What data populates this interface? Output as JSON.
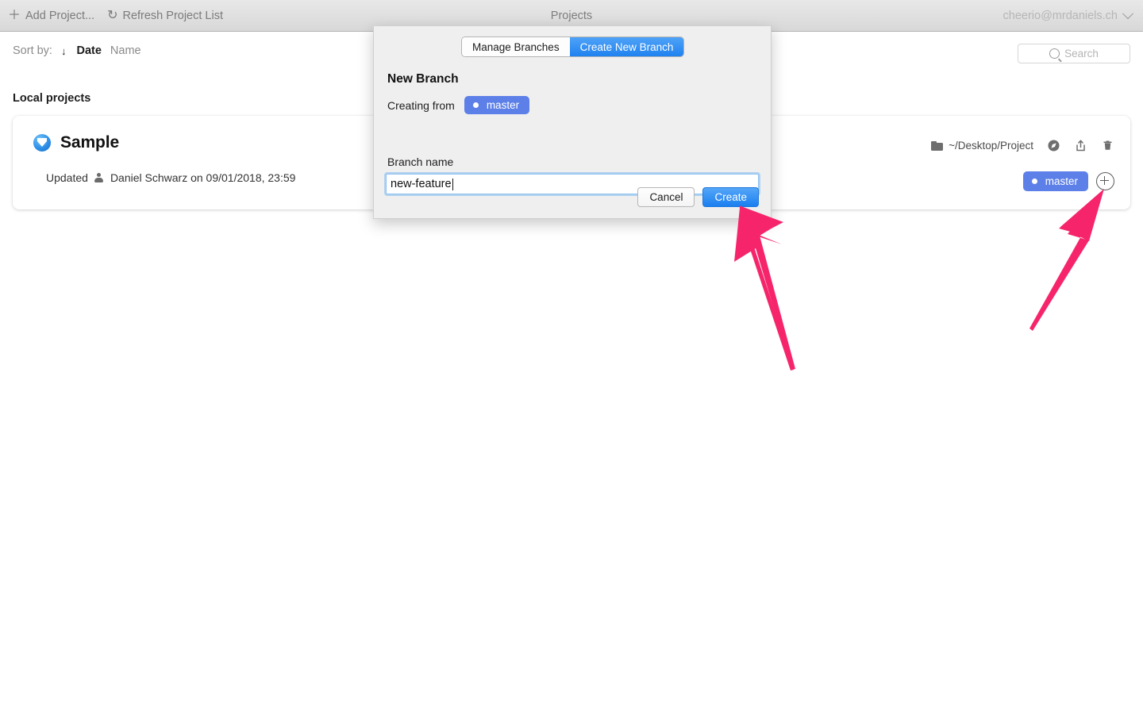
{
  "titlebar": {
    "add_project_label": "Add Project...",
    "add_project_icon": "plus-icon",
    "refresh_label": "Refresh Project List",
    "refresh_icon": "refresh-icon",
    "window_title": "Projects",
    "account_email": "cheerio@mrdaniels.ch",
    "account_chevron_icon": "chevron-down-icon"
  },
  "sortbar": {
    "label": "Sort by:",
    "arrow": "↓",
    "options": [
      {
        "label": "Date",
        "active": true
      },
      {
        "label": "Name",
        "active": false
      }
    ]
  },
  "search": {
    "placeholder": "Search",
    "icon": "search-icon",
    "value": ""
  },
  "section": {
    "title": "Local projects"
  },
  "project": {
    "name": "Sample",
    "icon": "project-shield-icon",
    "updated_word": "Updated",
    "author_icon": "person-icon",
    "author_and_date": "Daniel Schwarz on 09/01/2018, 23:59",
    "path": "~/Desktop/Project",
    "folder_icon": "folder-icon",
    "actions": [
      {
        "name": "compass-icon"
      },
      {
        "name": "share-icon"
      },
      {
        "name": "trash-icon"
      }
    ],
    "branch": "master",
    "branch_color": "#5d80e8",
    "add_branch_icon": "plus-circle-icon"
  },
  "dialog": {
    "tabs": [
      {
        "label": "Manage Branches",
        "active": false
      },
      {
        "label": "Create New Branch",
        "active": true
      }
    ],
    "heading": "New Branch",
    "creating_from_label": "Creating from",
    "creating_from_branch": "master",
    "branch_name_label": "Branch name",
    "branch_name_value": "new-feature",
    "branch_name_placeholder": "",
    "cancel_label": "Cancel",
    "create_label": "Create",
    "accent_color": "#1b7ff0"
  },
  "annotations": {
    "arrow_color": "#f6256b",
    "arrows": [
      {
        "name": "arrow-to-create-button"
      },
      {
        "name": "arrow-to-add-branch-button"
      }
    ]
  }
}
